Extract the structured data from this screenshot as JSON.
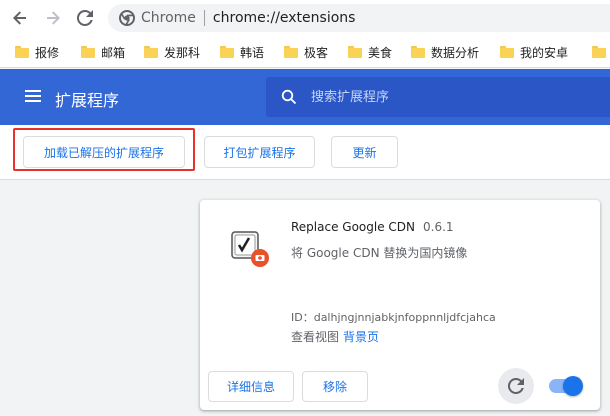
{
  "browser": {
    "site_label": "Chrome",
    "url": "chrome://extensions",
    "bookmarks": [
      {
        "label": "报修"
      },
      {
        "label": "邮箱"
      },
      {
        "label": "发那科"
      },
      {
        "label": "韩语"
      },
      {
        "label": "极客"
      },
      {
        "label": "美食"
      },
      {
        "label": "数据分析"
      },
      {
        "label": "我的安卓"
      }
    ]
  },
  "header": {
    "title": "扩展程序",
    "search_placeholder": "搜索扩展程序"
  },
  "actions": {
    "load_unpacked": "加载已解压的扩展程序",
    "pack": "打包扩展程序",
    "update": "更新"
  },
  "extension": {
    "name": "Replace Google CDN",
    "version": "0.6.1",
    "description": "将 Google CDN 替换为国内镜像",
    "id_text": "ID：dalhjngjnnjabkjnfoppnnljdfcjahca",
    "views_label": "查看视图",
    "views_link": "背景页",
    "details_button": "详细信息",
    "remove_button": "移除",
    "enabled": true
  },
  "colors": {
    "header_blue": "#3367d6",
    "accent": "#1a73e8",
    "highlight_red": "#e8312a"
  }
}
